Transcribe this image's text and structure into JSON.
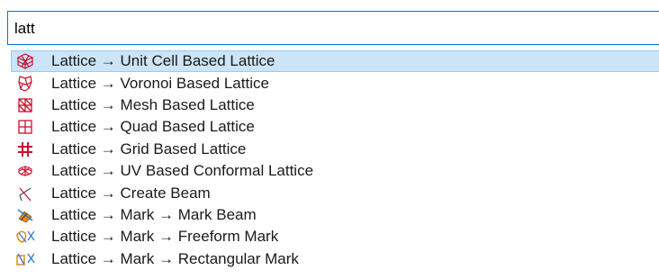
{
  "search": {
    "value": "latt"
  },
  "results": [
    {
      "label": "Lattice → Unit Cell Based Lattice",
      "icon": "unit-cell-lattice-icon",
      "selected": true
    },
    {
      "label": "Lattice → Voronoi Based Lattice",
      "icon": "voronoi-lattice-icon",
      "selected": false
    },
    {
      "label": "Lattice → Mesh Based Lattice",
      "icon": "mesh-lattice-icon",
      "selected": false
    },
    {
      "label": "Lattice → Quad Based Lattice",
      "icon": "quad-lattice-icon",
      "selected": false
    },
    {
      "label": "Lattice → Grid Based Lattice",
      "icon": "grid-lattice-icon",
      "selected": false
    },
    {
      "label": "Lattice → UV Based Conformal Lattice",
      "icon": "uv-conformal-lattice-icon",
      "selected": false
    },
    {
      "label": "Lattice → Create Beam",
      "icon": "create-beam-icon",
      "selected": false
    },
    {
      "label": "Lattice → Mark → Mark Beam",
      "icon": "mark-beam-icon",
      "selected": false
    },
    {
      "label": "Lattice → Mark → Freeform Mark",
      "icon": "freeform-mark-icon",
      "selected": false
    },
    {
      "label": "Lattice → Mark → Rectangular Mark",
      "icon": "rectangular-mark-icon",
      "selected": false
    }
  ],
  "colors": {
    "selection_bg": "#cce4f7",
    "selection_border": "#99c9ef",
    "input_border": "#0078d7",
    "icon_red": "#c8102e",
    "icon_blue": "#3a7bd5",
    "icon_orange": "#e08a1e"
  }
}
